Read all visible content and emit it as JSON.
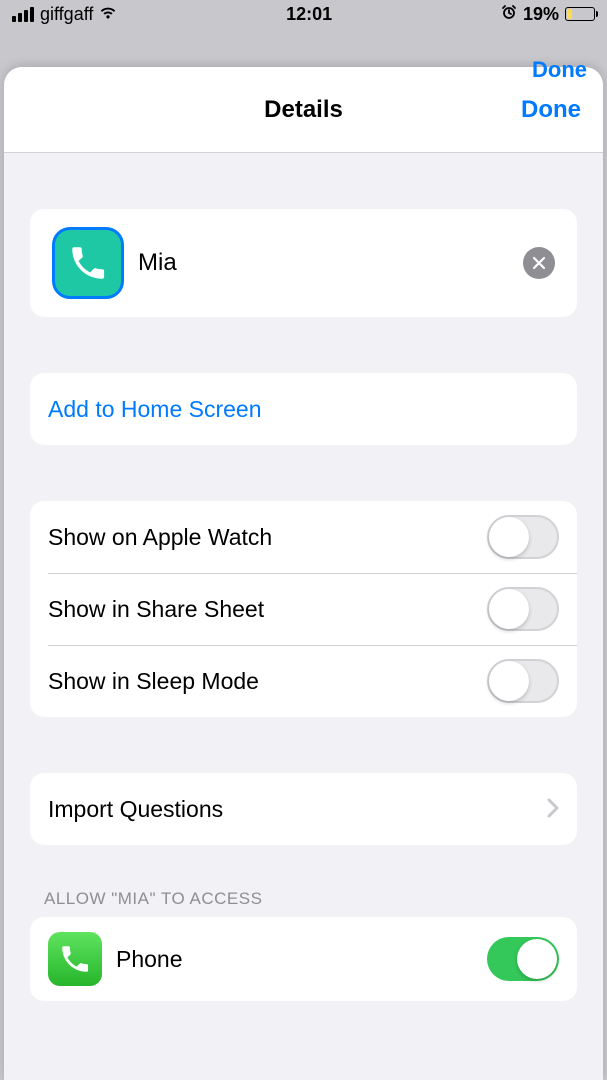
{
  "status_bar": {
    "carrier": "giffgaff",
    "time": "12:01",
    "battery_percent": "19%"
  },
  "back_sheet_done": "Done",
  "sheet": {
    "title": "Details",
    "done": "Done"
  },
  "shortcut": {
    "name": "Mia"
  },
  "actions": {
    "add_home": "Add to Home Screen"
  },
  "toggles": {
    "apple_watch": "Show on Apple Watch",
    "share_sheet": "Show in Share Sheet",
    "sleep_mode": "Show in Sleep Mode"
  },
  "import": {
    "label": "Import Questions"
  },
  "permissions": {
    "header": "Allow \"Mia\" to Access",
    "phone": "Phone"
  }
}
